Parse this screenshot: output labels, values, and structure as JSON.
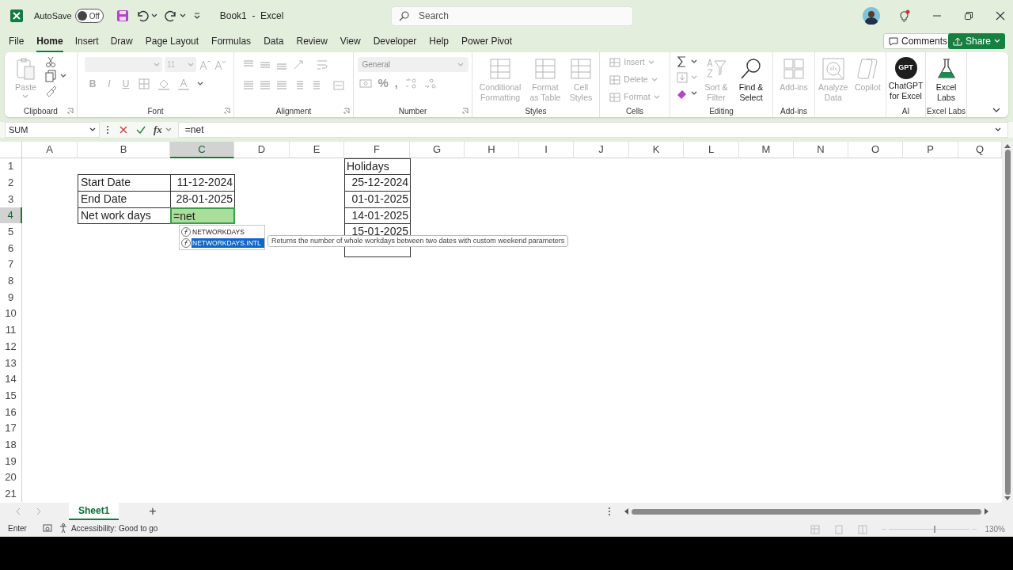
{
  "title_bar": {
    "autosave_label": "AutoSave",
    "autosave": {
      "on": false,
      "label": "Off"
    },
    "document_title": "Book1  -  Excel",
    "search": {
      "placeholder": "Search"
    }
  },
  "ribbon_tabs": [
    {
      "label": "File",
      "selected": false
    },
    {
      "label": "Home",
      "selected": true
    },
    {
      "label": "Insert",
      "selected": false
    },
    {
      "label": "Draw",
      "selected": false
    },
    {
      "label": "Page Layout",
      "selected": false
    },
    {
      "label": "Formulas",
      "selected": false
    },
    {
      "label": "Data",
      "selected": false
    },
    {
      "label": "Review",
      "selected": false
    },
    {
      "label": "View",
      "selected": false
    },
    {
      "label": "Developer",
      "selected": false
    },
    {
      "label": "Help",
      "selected": false
    },
    {
      "label": "Power Pivot",
      "selected": false
    }
  ],
  "ribbon_buttons": {
    "comments": "Comments",
    "share": "Share"
  },
  "ribbon": {
    "groups": [
      {
        "kind": "clipboard",
        "label": "Clipboard",
        "paste": {
          "label": "Paste",
          "disabled": true
        }
      },
      {
        "kind": "font",
        "label": "Font",
        "font_size": "11",
        "format_buttons": [
          "B",
          "I",
          "U"
        ]
      },
      {
        "kind": "alignment",
        "label": "Alignment"
      },
      {
        "kind": "number",
        "label": "Number",
        "format": "General",
        "symbols": [
          "%",
          ","
        ]
      },
      {
        "kind": "styles",
        "label": "Styles",
        "commands": [
          {
            "label": "Conditional Formatting",
            "disabled": true
          },
          {
            "label": "Format as Table",
            "disabled": true
          },
          {
            "label": "Cell Styles",
            "disabled": true
          }
        ]
      },
      {
        "kind": "cells",
        "label": "Cells",
        "commands": [
          {
            "label": "Insert",
            "disabled": true
          },
          {
            "label": "Delete",
            "disabled": true
          },
          {
            "label": "Format",
            "disabled": true
          }
        ]
      },
      {
        "kind": "editing",
        "label": "Editing",
        "commands": [
          {
            "label": "Sort & Filter",
            "disabled": true
          },
          {
            "label": "Find & Select",
            "disabled": false
          }
        ]
      },
      {
        "kind": "addins",
        "label": "Add-ins",
        "commands": [
          {
            "label": "Add-ins",
            "disabled": true
          }
        ]
      },
      {
        "kind": "analysis",
        "commands": [
          {
            "label": "Analyze Data",
            "disabled": true
          },
          {
            "label": "Copilot",
            "disabled": true
          }
        ]
      },
      {
        "kind": "ai",
        "label": "AI",
        "logo_text": "GPT",
        "commands": [
          {
            "label": "ChatGPT for Excel",
            "disabled": false
          }
        ]
      },
      {
        "kind": "labs",
        "label": "Excel Labs",
        "commands": [
          {
            "label": "Excel Labs",
            "disabled": false
          }
        ]
      }
    ]
  },
  "formula_bar": {
    "name_box": "SUM",
    "fx_label": "fx",
    "formula": "=net"
  },
  "sheet": {
    "columns": [
      {
        "label": "A",
        "selected": false
      },
      {
        "label": "B",
        "selected": false
      },
      {
        "label": "C",
        "selected": true
      },
      {
        "label": "D",
        "selected": false
      },
      {
        "label": "E",
        "selected": false
      },
      {
        "label": "F",
        "selected": false
      },
      {
        "label": "G",
        "selected": false
      },
      {
        "label": "H",
        "selected": false
      },
      {
        "label": "I",
        "selected": false
      },
      {
        "label": "J",
        "selected": false
      },
      {
        "label": "K",
        "selected": false
      },
      {
        "label": "L",
        "selected": false
      },
      {
        "label": "M",
        "selected": false
      },
      {
        "label": "N",
        "selected": false
      },
      {
        "label": "O",
        "selected": false
      },
      {
        "label": "P",
        "selected": false
      },
      {
        "label": "Q",
        "selected": false
      }
    ],
    "rows": [
      {
        "label": "1",
        "selected": false
      },
      {
        "label": "2",
        "selected": false
      },
      {
        "label": "3",
        "selected": false
      },
      {
        "label": "4",
        "selected": true
      },
      {
        "label": "5",
        "selected": false
      },
      {
        "label": "6",
        "selected": false
      },
      {
        "label": "7",
        "selected": false
      },
      {
        "label": "8",
        "selected": false
      },
      {
        "label": "9",
        "selected": false
      },
      {
        "label": "10",
        "selected": false
      },
      {
        "label": "11",
        "selected": false
      },
      {
        "label": "12",
        "selected": false
      },
      {
        "label": "13",
        "selected": false
      },
      {
        "label": "14",
        "selected": false
      },
      {
        "label": "15",
        "selected": false
      },
      {
        "label": "16",
        "selected": false
      },
      {
        "label": "17",
        "selected": false
      },
      {
        "label": "18",
        "selected": false
      },
      {
        "label": "19",
        "selected": false
      },
      {
        "label": "20",
        "selected": false
      },
      {
        "label": "21",
        "selected": false
      }
    ],
    "input_table": [
      {
        "label": "Start Date",
        "value": "11-12-2024",
        "editing": false
      },
      {
        "label": "End Date",
        "value": "28-01-2025",
        "editing": false
      },
      {
        "label": "Net work days",
        "value": "=net",
        "editing": true
      }
    ],
    "holidays": {
      "header": "Holidays",
      "dates": [
        "25-12-2024",
        "01-01-2025",
        "14-01-2025",
        "15-01-2025"
      ]
    },
    "autocomplete": {
      "items": [
        {
          "label": "NETWORKDAYS",
          "selected": false
        },
        {
          "label": "NETWORKDAYS.INTL",
          "selected": true
        }
      ],
      "tooltip": "Returns the number of whole workdays between two dates with custom weekend parameters"
    }
  },
  "sheet_tabs": [
    {
      "label": "Sheet1",
      "selected": true
    }
  ],
  "add_sheet": "+",
  "status_bar": {
    "mode": "Enter",
    "accessibility": "Accessibility: Good to go",
    "zoom": "130%",
    "zoom_slider": {
      "level": 0.55
    }
  }
}
